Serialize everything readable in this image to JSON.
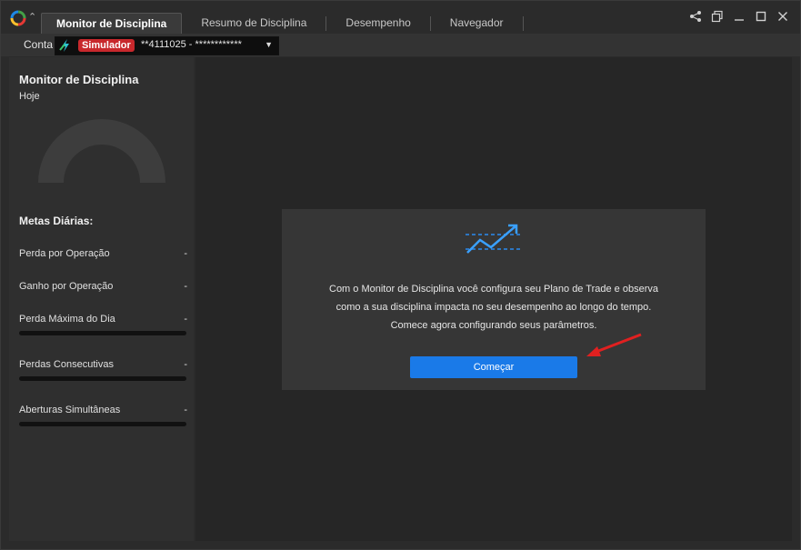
{
  "tabs": [
    {
      "label": "Monitor de Disciplina",
      "active": true
    },
    {
      "label": "Resumo de Disciplina",
      "active": false
    },
    {
      "label": "Desempenho",
      "active": false
    },
    {
      "label": "Navegador",
      "active": false
    }
  ],
  "window_controls": [
    "share-icon",
    "popout-icon",
    "minimize-icon",
    "maximize-icon",
    "close-icon"
  ],
  "account": {
    "label": "Conta",
    "badge": "Simulador",
    "number": "**4111025 - ************",
    "badge_color": "#c8282c"
  },
  "left_panel": {
    "title": "Monitor de Disciplina",
    "period": "Hoje",
    "goals_title": "Metas Diárias:",
    "goals": [
      {
        "label": "Perda por Operação",
        "value": "-",
        "has_bar": false
      },
      {
        "label": "Ganho por Operação",
        "value": "-",
        "has_bar": false
      },
      {
        "label": "Perda Máxima do Dia",
        "value": "-",
        "has_bar": true
      },
      {
        "label": "Perdas Consecutivas",
        "value": "-",
        "has_bar": true
      },
      {
        "label": "Aberturas Simultâneas",
        "value": "-",
        "has_bar": true
      }
    ]
  },
  "main": {
    "icon": "trend-chart-icon",
    "description_lines": [
      "Com o Monitor de Disciplina você configura seu Plano de Trade e observa",
      "como a sua disciplina impacta no seu desempenho ao longo do tempo.",
      "Comece agora configurando seus parâmetros."
    ],
    "start_button": "Começar",
    "accent_color": "#1a7ae8",
    "annotation_color": "#e02020"
  }
}
